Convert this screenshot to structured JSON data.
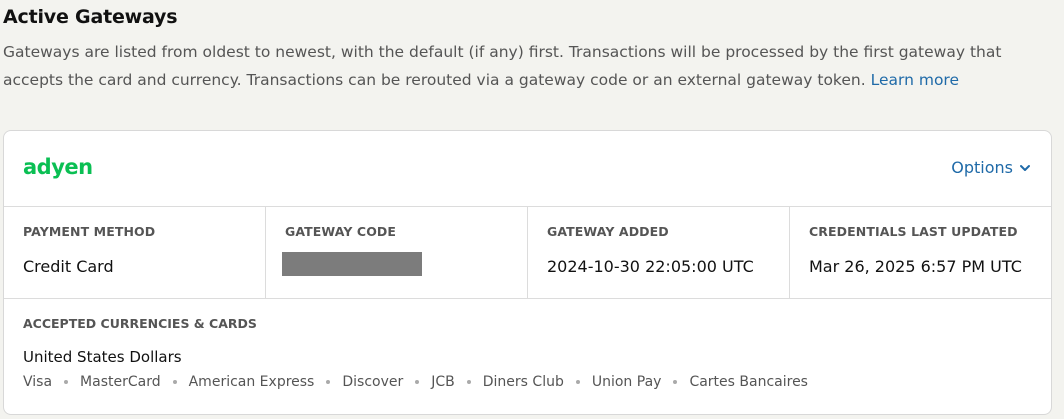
{
  "page": {
    "title": "Active Gateways",
    "description": "Gateways are listed from oldest to newest, with the default (if any) first. Transactions will be processed by the first gateway that accepts the card and currency. Transactions can be rerouted via a gateway code or an external gateway token.",
    "learn_more": "Learn more"
  },
  "gateway": {
    "logo_text": "adyen",
    "brand_color": "#0abf53",
    "options_label": "Options",
    "options_icon": "chevron-down-icon",
    "fields": {
      "payment_method": {
        "label": "PAYMENT METHOD",
        "value": "Credit Card"
      },
      "gateway_code": {
        "label": "GATEWAY CODE",
        "value_redacted": true
      },
      "gateway_added": {
        "label": "GATEWAY ADDED",
        "value": "2024-10-30 22:05:00 UTC"
      },
      "credentials_updated": {
        "label": "CREDENTIALS LAST UPDATED",
        "value": "Mar 26, 2025 6:57 PM UTC"
      }
    },
    "accepted": {
      "label": "ACCEPTED CURRENCIES & CARDS",
      "currency": "United States Dollars",
      "cards": [
        "Visa",
        "MasterCard",
        "American Express",
        "Discover",
        "JCB",
        "Diners Club",
        "Union Pay",
        "Cartes Bancaires"
      ]
    }
  },
  "colors": {
    "link": "#1f6aa8",
    "background": "#f3f3ef"
  }
}
